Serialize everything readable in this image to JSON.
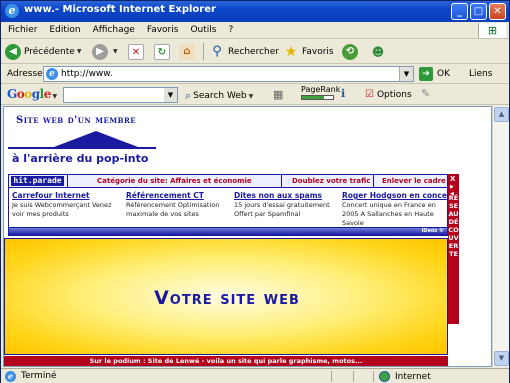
{
  "window": {
    "title": "www.- Microsoft Internet Explorer",
    "controls": {
      "minimize": "_",
      "maximize": "□",
      "close": "✕"
    }
  },
  "menu": {
    "items": [
      "Fichier",
      "Edition",
      "Affichage",
      "Favoris",
      "Outils",
      "?"
    ]
  },
  "toolbar": {
    "back_label": "Précédente",
    "search_label": "Rechercher",
    "favorites_label": "Favoris"
  },
  "address": {
    "label": "Adresse",
    "url": "http://www.",
    "go_label": "OK",
    "links_label": "Liens"
  },
  "googlebar": {
    "logo": "Google",
    "search_value": "",
    "search_web_label": "Search Web",
    "pagerank_label": "PageRank",
    "pagerank_level": 0.7,
    "options_label": "Options"
  },
  "page": {
    "member_title": "Site web d'un membre",
    "member_subtitle": "à l'arrière du pop-into",
    "banner": {
      "logo": "hit.parade",
      "category": "Catégorie du site: Affaires et économie",
      "double_traffic": "Doublez votre trafic",
      "remove_frame": "Enlever le cadre",
      "ads": [
        {
          "title": "Carrefour Internet",
          "desc": "Je suis Webcommerçant Venez voir mes produits"
        },
        {
          "title": "Référencement CT",
          "desc": "Référencement Optimisation maximale de vos sites"
        },
        {
          "title": "Dites non aux spams",
          "desc": "15 jours d'essai gratuitement Offert par Spamfinal"
        },
        {
          "title": "Roger Hodgson en concert",
          "desc": "Concert unique en France en 2005 A Sallanches en Haute Savoie"
        }
      ],
      "foot_small": "iDeos ©"
    },
    "reseau": {
      "close": "X",
      "text": "RÉSEAU DÉCOUVERTE"
    },
    "main_title": "Votre site web",
    "podium": "Sur le podium : Site de Lenwé - voila un site qui parle graphisme, motos..."
  },
  "status": {
    "text": "Terminé",
    "zone": "Internet"
  }
}
